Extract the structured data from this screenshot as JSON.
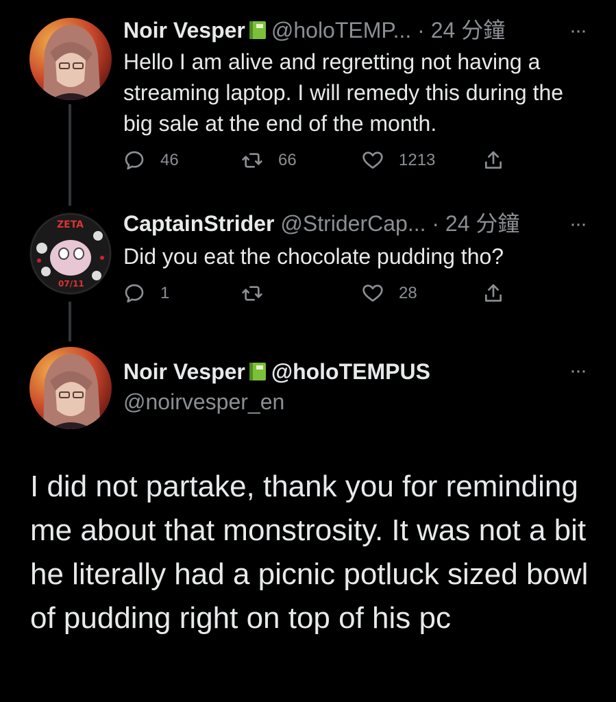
{
  "tweet1": {
    "display_name": "Noir Vesper",
    "badge": "green-book-emoji",
    "handle": "@holoTEMP...",
    "separator": "·",
    "time": "24 分鐘",
    "text": "Hello I am alive and regretting not having a streaming laptop. I will remedy this during the big sale at the end of the month.",
    "replies": "46",
    "retweets": "66",
    "likes": "1213"
  },
  "tweet2": {
    "display_name": "CaptainStrider",
    "handle": "@StriderCap...",
    "separator": "·",
    "time": "24 分鐘",
    "text": "Did you eat the chocolate pudding tho?",
    "replies": "1",
    "retweets": "",
    "likes": "28",
    "avatar_text_top": "ZETA",
    "avatar_text_bottom": "07/11"
  },
  "tweet3": {
    "display_name": "Noir Vesper",
    "badge": "green-book-emoji",
    "handle": "@holoTEMPUS",
    "sub_handle": "@noirvesper_en",
    "text": "I did not partake, thank you for reminding me about that monstrosity. It was not a bit he literally had a picnic potluck sized bowl of pudding right on top of his pc"
  },
  "more_label": "···",
  "colors": {
    "background": "#000000",
    "text_primary": "#e7e9ea",
    "text_secondary": "#8b8f94",
    "thread_line": "#333639"
  }
}
